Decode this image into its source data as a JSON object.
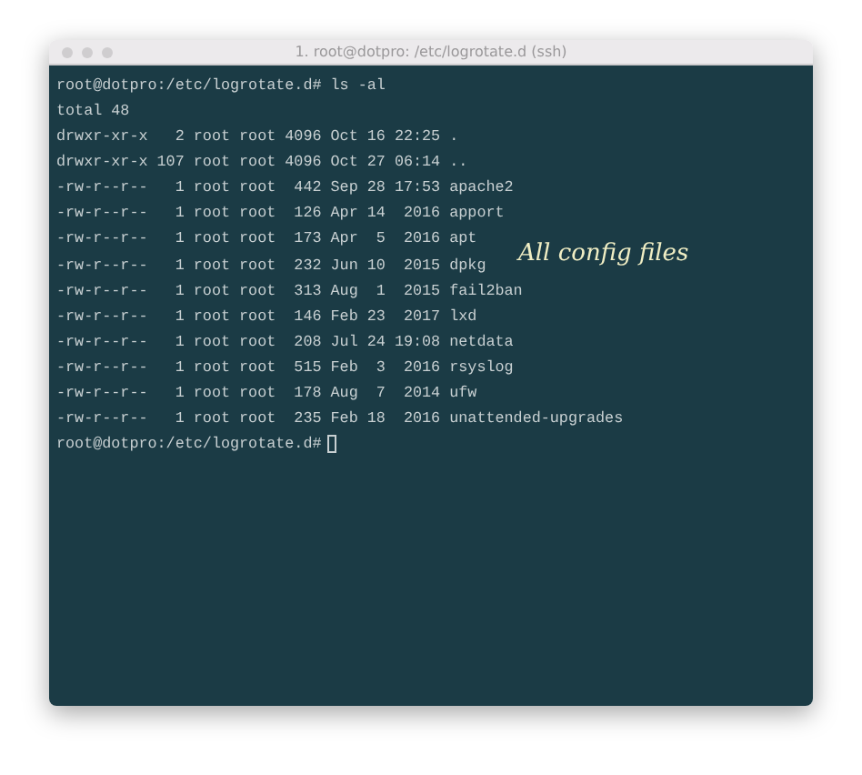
{
  "window": {
    "title": "1. root@dotpro: /etc/logrotate.d (ssh)"
  },
  "terminal": {
    "lines": [
      {
        "kind": "prompt",
        "prompt": "root@dotpro:/etc/logrotate.d#",
        "command": "ls -al"
      },
      {
        "kind": "output",
        "text": "total 48"
      },
      {
        "kind": "output",
        "text": "drwxr-xr-x   2 root root 4096 Oct 16 22:25 ."
      },
      {
        "kind": "output",
        "text": "drwxr-xr-x 107 root root 4096 Oct 27 06:14 .."
      },
      {
        "kind": "output",
        "text": "-rw-r--r--   1 root root  442 Sep 28 17:53 apache2"
      },
      {
        "kind": "output",
        "text": "-rw-r--r--   1 root root  126 Apr 14  2016 apport"
      },
      {
        "kind": "output",
        "text": "-rw-r--r--   1 root root  173 Apr  5  2016 apt"
      },
      {
        "kind": "output",
        "text": "-rw-r--r--   1 root root  232 Jun 10  2015 dpkg"
      },
      {
        "kind": "output",
        "text": "-rw-r--r--   1 root root  313 Aug  1  2015 fail2ban"
      },
      {
        "kind": "output",
        "text": "-rw-r--r--   1 root root  146 Feb 23  2017 lxd"
      },
      {
        "kind": "output",
        "text": "-rw-r--r--   1 root root  208 Jul 24 19:08 netdata"
      },
      {
        "kind": "output",
        "text": "-rw-r--r--   1 root root  515 Feb  3  2016 rsyslog"
      },
      {
        "kind": "output",
        "text": "-rw-r--r--   1 root root  178 Aug  7  2014 ufw"
      },
      {
        "kind": "output",
        "text": "-rw-r--r--   1 root root  235 Feb 18  2016 unattended-upgrades"
      },
      {
        "kind": "prompt",
        "prompt": "root@dotpro:/etc/logrotate.d#",
        "cursor": true
      }
    ]
  },
  "annotation": {
    "text": "All config files"
  }
}
